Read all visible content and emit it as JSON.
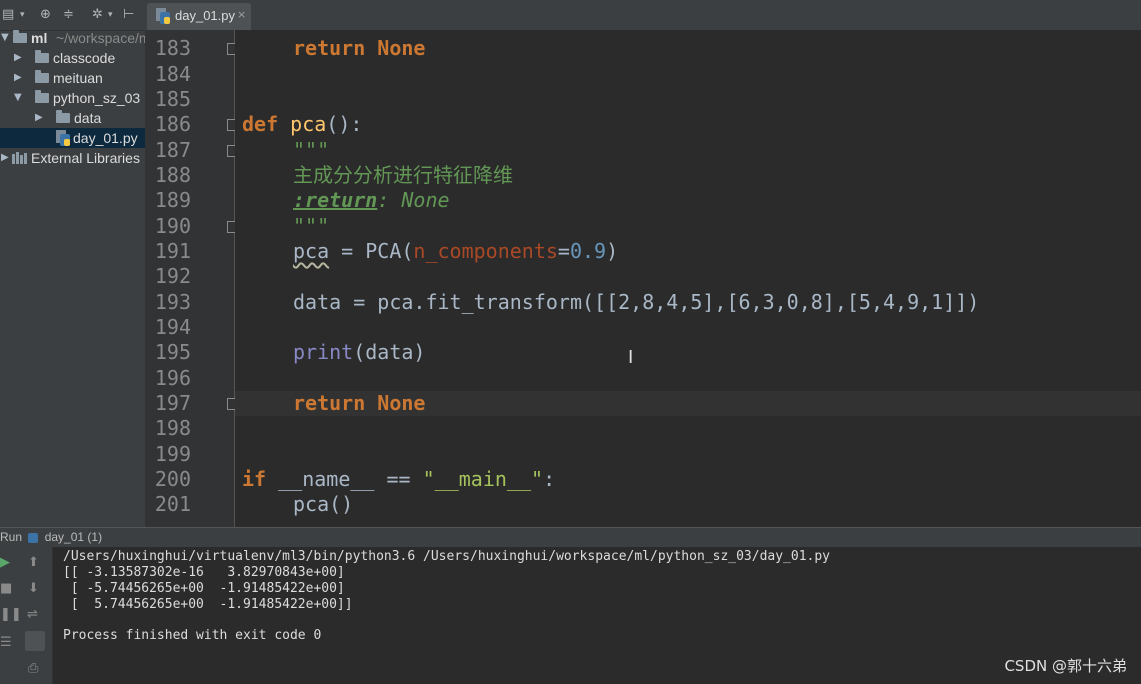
{
  "sidebar": {
    "root": {
      "name": "ml",
      "path": "~/workspace/ml"
    },
    "items": [
      {
        "label": "classcode"
      },
      {
        "label": "meituan"
      },
      {
        "label": "python_sz_03"
      },
      {
        "label": "data"
      },
      {
        "label": "day_01.py"
      },
      {
        "label": "External Libraries"
      }
    ]
  },
  "tabs": [
    {
      "label": "day_01.py",
      "close": "×"
    }
  ],
  "editor": {
    "line_numbers": [
      "183",
      "184",
      "185",
      "186",
      "187",
      "188",
      "189",
      "190",
      "191",
      "192",
      "193",
      "194",
      "195",
      "196",
      "197",
      "198",
      "199",
      "200",
      "201"
    ],
    "code": {
      "l183_kw": "return",
      "l183_val": "None",
      "l186_kw": "def",
      "l186_fn": "pca",
      "l186_rest": "():",
      "l187": "\"\"\"",
      "l188": "主成分分析进行特征降维",
      "l189_tag": ":return",
      "l189_rest": ": None",
      "l190": "\"\"\"",
      "l191_var": "pca",
      "l191_eq": " = PCA(",
      "l191_param": "n_components",
      "l191_eq2": "=",
      "l191_num": "0.9",
      "l191_close": ")",
      "l193": "data = pca.fit_transform([[2,8,4,5],[6,3,0,8],[5,4,9,1]])",
      "l195_fn": "print",
      "l195_rest": "(data)",
      "l197_kw": "return",
      "l197_val": "None",
      "l200_kw": "if",
      "l200_dunder": "__name__",
      "l200_op": " == ",
      "l200_str": "\"__main__\"",
      "l200_colon": ":",
      "l201": "pca()"
    }
  },
  "run": {
    "title": "Run",
    "config": "day_01 (1)",
    "output": [
      "/Users/huxinghui/virtualenv/ml3/bin/python3.6 /Users/huxinghui/workspace/ml/python_sz_03/day_01.py",
      "[[ -3.13587302e-16   3.82970843e+00]",
      " [ -5.74456265e+00  -1.91485422e+00]",
      " [  5.74456265e+00  -1.91485422e+00]]",
      "",
      "Process finished with exit code 0"
    ]
  },
  "watermark": "CSDN @郭十六弟",
  "colors": {
    "keyword": "#cc7832",
    "function": "#ffc66d",
    "string": "#6a8759",
    "number": "#6897bb",
    "background": "#2b2b2b"
  }
}
